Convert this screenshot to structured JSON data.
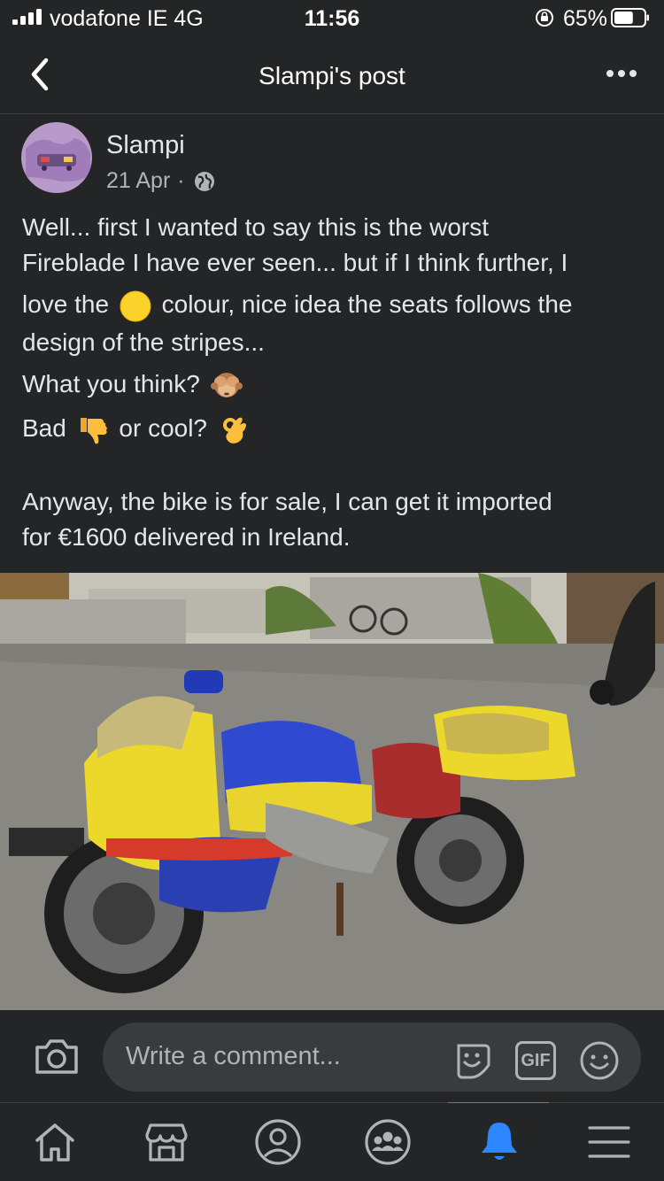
{
  "status_bar": {
    "carrier": "vodafone IE  4G",
    "time": "11:56",
    "battery": "65%",
    "battery_level": 0.65
  },
  "header": {
    "title": "Slampi's post"
  },
  "post": {
    "author": "Slampi",
    "date": "21 Apr",
    "separator": "·",
    "lines": {
      "l1": "Well... first I wanted to say this is the worst",
      "l2": "Fireblade I have ever seen... but if I think further, I",
      "l3a": "love the",
      "l3b": "colour, nice idea the seats follows the",
      "l4": "design of the stripes...",
      "l5": "What you think?",
      "l6a": "Bad",
      "l6b": "or cool?",
      "l7": "Anyway, the bike is for sale, I can get it imported",
      "l8": "for €1600 delivered in Ireland."
    },
    "emojis": [
      "yellow-circle",
      "see-no-evil-monkey",
      "thumbs-down",
      "ok-hand"
    ]
  },
  "comment_bar": {
    "placeholder": "Write a comment...",
    "gif_label": "GIF"
  },
  "tabs": [
    "home",
    "marketplace",
    "profile",
    "groups",
    "notifications",
    "menu"
  ],
  "active_tab": "notifications",
  "colors": {
    "background": "#242526",
    "input": "#3a3b3c",
    "accent": "#2d88ff",
    "text": "#e4e6eb",
    "secondary": "#b0b3b8"
  }
}
